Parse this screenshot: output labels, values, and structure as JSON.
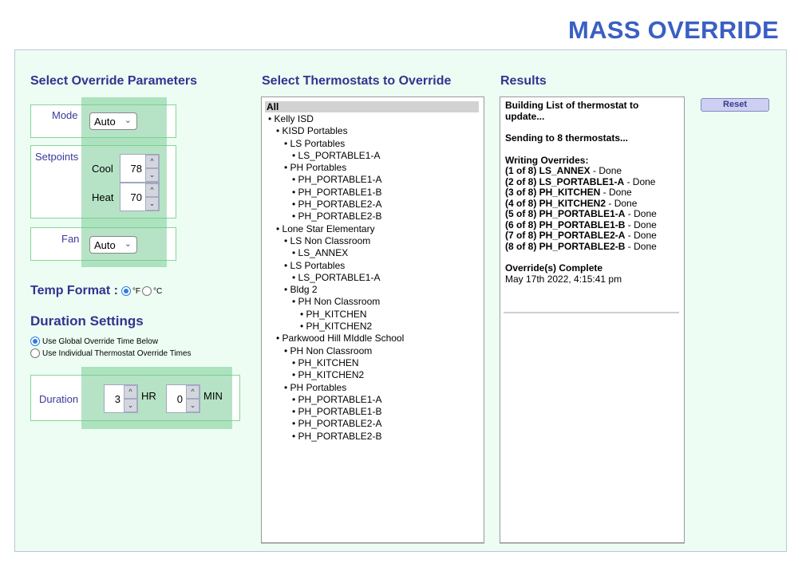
{
  "header": {
    "title": "MASS OVERRIDE"
  },
  "params": {
    "heading": "Select Override Parameters",
    "mode": {
      "label": "Mode",
      "value": "Auto"
    },
    "setpoints": {
      "label": "Setpoints",
      "cool": {
        "label": "Cool",
        "value": "78"
      },
      "heat": {
        "label": "Heat",
        "value": "70"
      }
    },
    "fan": {
      "label": "Fan",
      "value": "Auto"
    },
    "temp_format": {
      "label": "Temp Format :",
      "options": [
        {
          "label": "°F",
          "checked": true
        },
        {
          "label": "°C",
          "checked": false
        }
      ]
    }
  },
  "duration": {
    "heading": "Duration Settings",
    "options": [
      {
        "label": "Use Global Override Time Below",
        "checked": true
      },
      {
        "label": "Use Individual Thermostat Override Times",
        "checked": false
      }
    ],
    "label": "Duration",
    "hours": {
      "value": "3",
      "unit": "HR"
    },
    "minutes": {
      "value": "0",
      "unit": "MIN"
    }
  },
  "thermostats": {
    "heading": "Select Thermostats to Override",
    "all_label": "All",
    "items": [
      {
        "label": "• Kelly ISD",
        "level": 1
      },
      {
        "label": "• KISD Portables",
        "level": 2
      },
      {
        "label": "• LS Portables",
        "level": 3
      },
      {
        "label": "• LS_PORTABLE1-A",
        "level": 4
      },
      {
        "label": "• PH Portables",
        "level": 3
      },
      {
        "label": "• PH_PORTABLE1-A",
        "level": 4
      },
      {
        "label": "• PH_PORTABLE1-B",
        "level": 4
      },
      {
        "label": "• PH_PORTABLE2-A",
        "level": 4
      },
      {
        "label": "• PH_PORTABLE2-B",
        "level": 4
      },
      {
        "label": "• Lone Star Elementary",
        "level": 2
      },
      {
        "label": "• LS Non Classroom",
        "level": 3
      },
      {
        "label": "• LS_ANNEX",
        "level": 4
      },
      {
        "label": "• LS Portables",
        "level": 3
      },
      {
        "label": "• LS_PORTABLE1-A",
        "level": 4
      },
      {
        "label": "• Bldg 2",
        "level": 3
      },
      {
        "label": "• PH Non Classroom",
        "level": 4
      },
      {
        "label": "• PH_KITCHEN",
        "level": 5
      },
      {
        "label": "• PH_KITCHEN2",
        "level": 5
      },
      {
        "label": "• Parkwood Hill MIddle School",
        "level": 2
      },
      {
        "label": "• PH Non Classroom",
        "level": 3
      },
      {
        "label": "• PH_KITCHEN",
        "level": 4
      },
      {
        "label": "• PH_KITCHEN2",
        "level": 4
      },
      {
        "label": "• PH Portables",
        "level": 3
      },
      {
        "label": "• PH_PORTABLE1-A",
        "level": 4
      },
      {
        "label": "• PH_PORTABLE1-B",
        "level": 4
      },
      {
        "label": "• PH_PORTABLE2-A",
        "level": 4
      },
      {
        "label": "• PH_PORTABLE2-B",
        "level": 4
      }
    ]
  },
  "results": {
    "heading": "Results",
    "building": "Building List of thermostat to update...",
    "sending": "Sending to 8 thermostats...",
    "writing": "Writing Overrides:",
    "lines": [
      {
        "prefix": "(1 of 8) LS_ANNEX",
        "status": " - Done"
      },
      {
        "prefix": "(2 of 8) LS_PORTABLE1-A",
        "status": " - Done"
      },
      {
        "prefix": "(3 of 8) PH_KITCHEN",
        "status": " - Done"
      },
      {
        "prefix": "(4 of 8) PH_KITCHEN2",
        "status": " - Done"
      },
      {
        "prefix": "(5 of 8) PH_PORTABLE1-A",
        "status": " - Done"
      },
      {
        "prefix": "(6 of 8) PH_PORTABLE1-B",
        "status": " - Done"
      },
      {
        "prefix": "(7 of 8) PH_PORTABLE2-A",
        "status": " - Done"
      },
      {
        "prefix": "(8 of 8) PH_PORTABLE2-B",
        "status": " - Done"
      }
    ],
    "complete": "Override(s) Complete",
    "timestamp": "May 17th 2022, 4:15:41 pm",
    "reset_label": "Reset"
  }
}
